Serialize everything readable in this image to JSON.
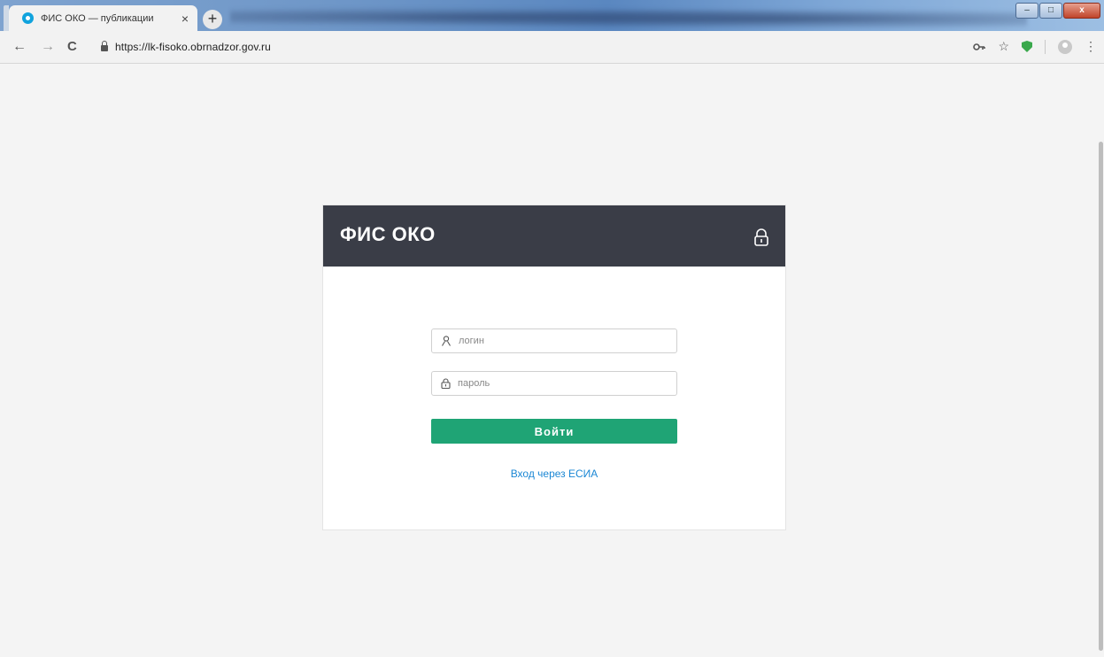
{
  "browser": {
    "tab_title": "ФИС ОКО — публикации",
    "tab_close": "×",
    "new_tab": "+",
    "url": "https://lk-fisoko.obrnadzor.gov.ru",
    "window_buttons": {
      "minimize": "–",
      "maximize": "□",
      "close": "x"
    },
    "nav": {
      "back": "←",
      "forward": "→",
      "reload": "C"
    },
    "toolbar_icons": [
      "key-icon",
      "star-icon",
      "shield-extension-icon",
      "profile-icon",
      "menu-icon"
    ]
  },
  "login": {
    "brand": "ФИС ОКО",
    "login_placeholder": "логин",
    "password_placeholder": "пароль",
    "submit_label": "Войти",
    "esia_link": "Вход через ЕСИА"
  },
  "colors": {
    "header_bg": "#3a3d47",
    "button_bg": "#1fa475",
    "link": "#1b87d4",
    "page_bg": "#f4f4f4"
  }
}
